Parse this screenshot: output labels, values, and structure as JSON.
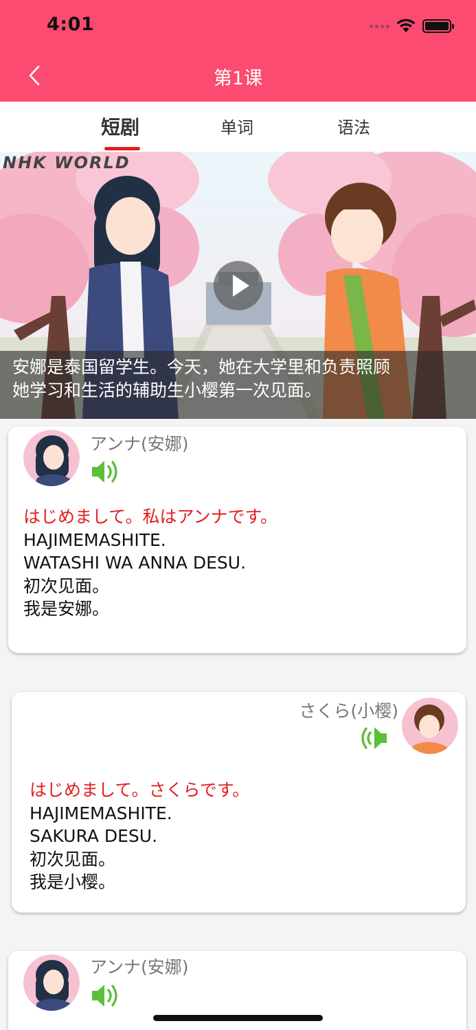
{
  "status_bar": {
    "time": "4:01"
  },
  "nav": {
    "title": "第1课",
    "back_icon": "chevron-left-icon"
  },
  "tabs": [
    {
      "label": "短剧",
      "active": true
    },
    {
      "label": "单词",
      "active": false
    },
    {
      "label": "语法",
      "active": false
    }
  ],
  "video": {
    "watermark": "NHK WORLD",
    "caption_line1": "安娜是泰国留学生。今天，她在大学里和负责照顾",
    "caption_line2": "她学习和生活的辅助生小樱第一次见面。",
    "play_icon": "play-icon"
  },
  "dialogue": [
    {
      "speaker": "アンナ(安娜)",
      "side": "left",
      "jp": "はじめまして。私はアンナです。",
      "romaji1": "HAJIMEMASHITE.",
      "romaji2": "WATASHI WA ANNA DESU.",
      "cn1": "初次见面。",
      "cn2": "我是安娜。"
    },
    {
      "speaker": "さくら(小樱)",
      "side": "right",
      "jp": "はじめまして。さくらです。",
      "romaji1": "HAJIMEMASHITE.",
      "romaji2": "SAKURA DESU.",
      "cn1": "初次见面。",
      "cn2": "我是小樱。"
    },
    {
      "speaker": "アンナ(安娜)",
      "side": "left"
    }
  ],
  "colors": {
    "brand": "#fb4b70",
    "jp_text": "#e31d1d",
    "speaker_icon": "#5cbf3a"
  }
}
